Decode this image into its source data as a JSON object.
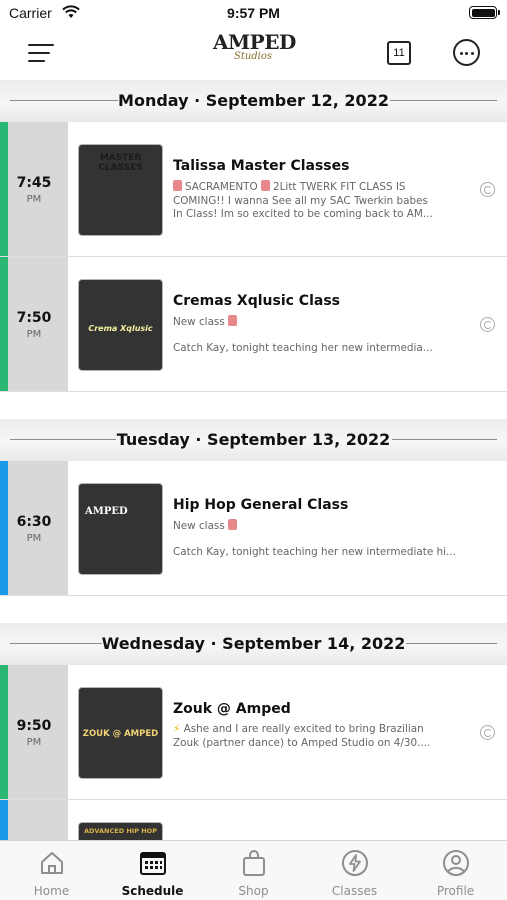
{
  "status_bar": {
    "carrier": "Carrier",
    "time": "9:57 PM"
  },
  "header": {
    "logo_text": "AMPED",
    "logo_script": "Studios",
    "calendar_day": "11"
  },
  "days": [
    {
      "label": "Monday · September 12, 2022",
      "events": [
        {
          "time": "7:45",
          "ampm": "PM",
          "accent": "#2ab673",
          "title": "Talissa Master Classes",
          "desc": [
            "SACRAMENTO",
            "2Litt TWERK FIT CLASS IS COMING!! I wanna See all my SAC Twerkin babes In Class! Im so excited to be coming back to AM..."
          ],
          "thumb_text": "MASTER CLASSES"
        },
        {
          "time": "7:50",
          "ampm": "PM",
          "accent": "#2ab673",
          "title": "Cremas Xqlusic Class",
          "desc": [
            "New class",
            "Catch Kay, tonight teaching her new intermedia..."
          ],
          "thumb_text": "Crema Xqlusic"
        }
      ]
    },
    {
      "label": "Tuesday · September 13, 2022",
      "events": [
        {
          "time": "6:30",
          "ampm": "PM",
          "accent": "#1a9ae6",
          "title": "Hip Hop General Class",
          "desc": [
            "New class",
            "Catch Kay, tonight teaching her new intermediate hi..."
          ],
          "thumb_text": "AMPED"
        }
      ]
    },
    {
      "label": "Wednesday · September 14, 2022",
      "events": [
        {
          "time": "9:50",
          "ampm": "PM",
          "accent": "#2ab673",
          "title": "Zouk @ Amped",
          "desc": [
            "Ashe and I are really excited to bring Brazilian Zouk (partner dance) to Amped Studio on 4/30...."
          ],
          "thumb_text": "ZOUK @ AMPED"
        },
        {
          "time": "",
          "ampm": "",
          "accent": "#1a9ae6",
          "title": "",
          "desc": [],
          "thumb_text": "ADVANCED HIP HOP"
        }
      ]
    }
  ],
  "tabs": [
    {
      "label": "Home",
      "icon": "home-icon"
    },
    {
      "label": "Schedule",
      "icon": "calendar-icon",
      "active": true
    },
    {
      "label": "Shop",
      "icon": "shopping-bag-icon"
    },
    {
      "label": "Classes",
      "icon": "bolt-icon"
    },
    {
      "label": "Profile",
      "icon": "person-icon"
    }
  ]
}
